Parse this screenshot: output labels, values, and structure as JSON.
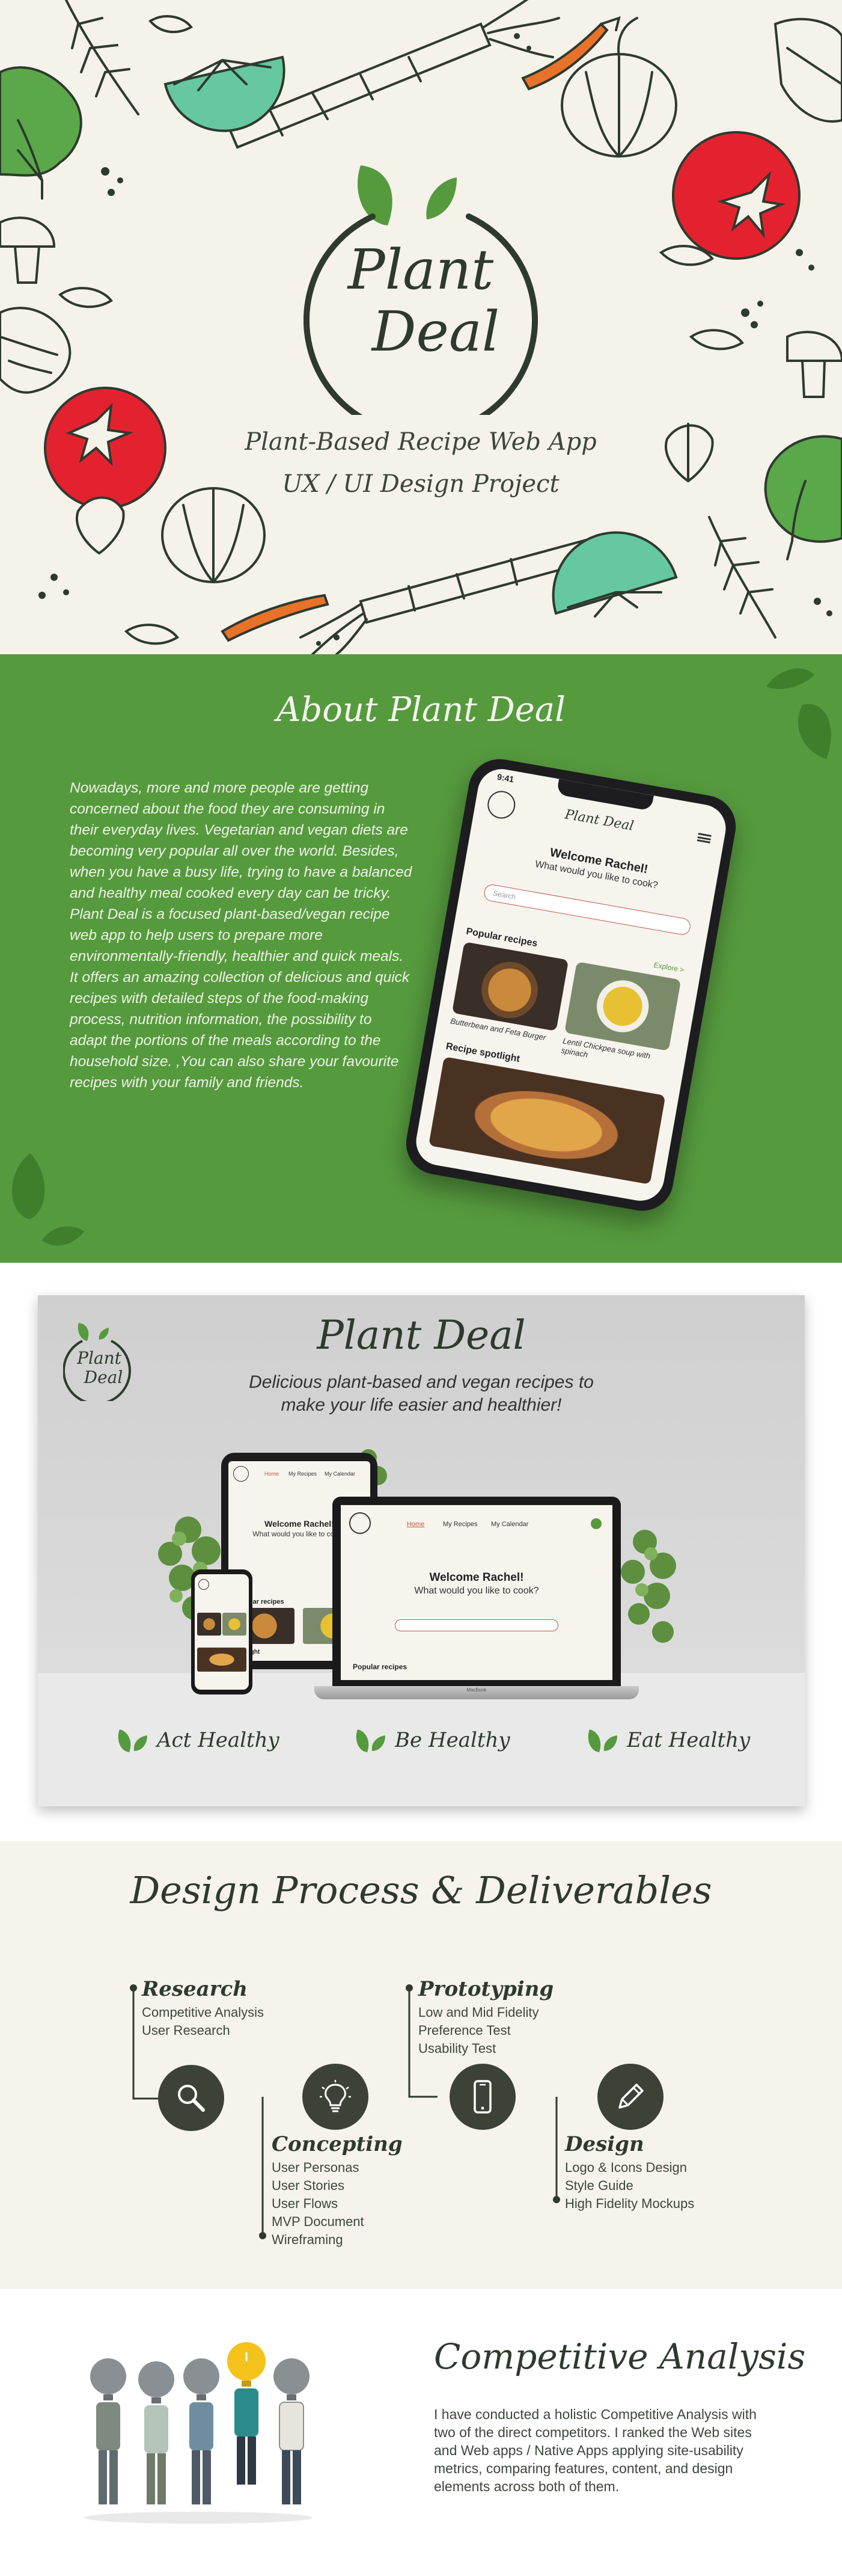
{
  "hero": {
    "logo_line1": "Plant",
    "logo_line2": "Deal",
    "subtitle1": "Plant-Based Recipe Web App",
    "subtitle2": "UX / UI Design Project"
  },
  "about": {
    "title": "About Plant Deal",
    "paragraphs": [
      "Nowadays, more and more people are getting concerned about the food they are consuming in their everyday lives. Vegetarian and vegan diets are becoming very popular all over the world. Besides, when you have a busy life, trying to have a balanced and healthy meal cooked every day can be tricky.",
      "Plant Deal is a focused plant-based/vegan recipe web app to help users to prepare more environmentally-friendly, healthier and quick meals.",
      "It offers an amazing collection of delicious and quick recipes with detailed steps of the food-making process, nutrition information, the possibility to adapt the portions of the meals according to the household size. ,You can also share your favourite recipes with your family and friends."
    ],
    "phone": {
      "time": "9:41",
      "brand": "Plant Deal",
      "welcome": "Welcome Rachel!",
      "ask": "What would you like to cook?",
      "search_placeholder": "Search",
      "popular_label": "Popular recipes",
      "explore_label": "Explore >",
      "card1": "Butterbean and Feta Burger",
      "card2": "Lentil Chickpea soup with spinach",
      "spotlight_label": "Recipe spotlight"
    }
  },
  "product": {
    "logo_line1": "Plant",
    "logo_line2": "Deal",
    "title": "Plant Deal",
    "tagline1": "Delicious plant-based and vegan recipes to",
    "tagline2": "make your life easier and healthier!",
    "welcome": "Welcome Rachel!",
    "ask": "What would you like to cook?",
    "nav": [
      "Home",
      "My Recipes",
      "My Calendar"
    ],
    "popular_label": "Popular recipes",
    "spotlight_label": "spotlight",
    "laptop_label": "MacBook",
    "mottos": [
      "Act Healthy",
      "Be Healthy",
      "Eat Healthy"
    ]
  },
  "process": {
    "title": "Design Process & Deliverables",
    "steps": [
      {
        "title": "Research",
        "items": [
          "Competitive Analysis",
          "User Research"
        ],
        "icon": "magnifier-icon"
      },
      {
        "title": "Concepting",
        "items": [
          "User Personas",
          "User Stories",
          "User Flows",
          "MVP Document",
          "Wireframing"
        ],
        "icon": "lightbulb-icon"
      },
      {
        "title": "Prototyping",
        "items": [
          "Low and Mid Fidelity",
          "Preference Test",
          "Usability Test"
        ],
        "icon": "smartphone-icon"
      },
      {
        "title": "Design",
        "items": [
          "Logo & Icons Design",
          "Style Guide",
          "High Fidelity Mockups"
        ],
        "icon": "pencil-icon"
      }
    ]
  },
  "compete": {
    "title": "Competitive Analysis",
    "text": "I have conducted a holistic Competitive Analysis with two of the direct competitors. I ranked the Web sites and Web apps / Native Apps applying site-usability metrics, comparing features, content, and design elements across both of them."
  },
  "colors": {
    "brand_green": "#569a3e",
    "dark": "#2e3a2e",
    "cream": "#f5f2ea",
    "tomato": "#e4222f",
    "lime": "#66c8a0",
    "carrot": "#e8722a"
  }
}
